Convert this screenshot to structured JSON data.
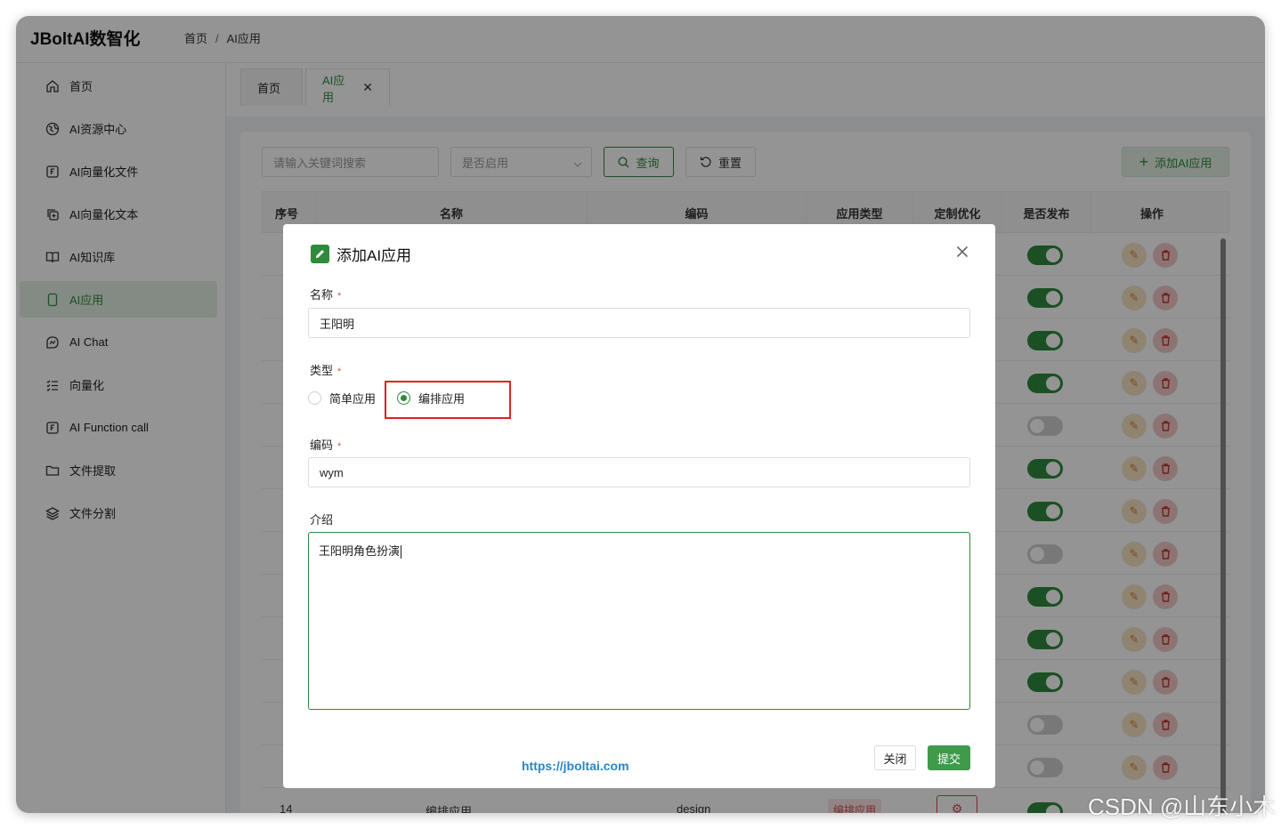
{
  "app": {
    "brand": "JBoltAI数智化"
  },
  "breadcrumb": {
    "home": "首页",
    "separator": "/",
    "current": "AI应用"
  },
  "sidebar": {
    "items": [
      {
        "label": "首页",
        "icon": "home-icon"
      },
      {
        "label": "AI资源中心",
        "icon": "globe-icon"
      },
      {
        "label": "AI向量化文件",
        "icon": "file-f-icon"
      },
      {
        "label": "AI向量化文本",
        "icon": "copy-plus-icon"
      },
      {
        "label": "AI知识库",
        "icon": "book-icon"
      },
      {
        "label": "AI应用",
        "icon": "phone-icon",
        "active": true
      },
      {
        "label": "AI Chat",
        "icon": "chat-icon"
      },
      {
        "label": "向量化",
        "icon": "list-icon"
      },
      {
        "label": "AI Function call",
        "icon": "function-icon"
      },
      {
        "label": "文件提取",
        "icon": "folder-icon"
      },
      {
        "label": "文件分割",
        "icon": "layers-icon"
      }
    ]
  },
  "tabs": [
    {
      "label": "首页"
    },
    {
      "label": "AI应用",
      "close": "✕"
    }
  ],
  "toolbar": {
    "search_placeholder": "请输入关键词搜索",
    "select_placeholder": "是否启用",
    "query_label": "查询",
    "reset_label": "重置",
    "add_label": "添加AI应用"
  },
  "table": {
    "headers": [
      "序号",
      "名称",
      "编码",
      "应用类型",
      "定制优化",
      "是否发布",
      "操作"
    ],
    "published": [
      true,
      true,
      true,
      true,
      false,
      true,
      true,
      false,
      true,
      true,
      true,
      false,
      false
    ],
    "last_row": {
      "index": "14",
      "name": "编排应用",
      "code": "design",
      "type": "编排应用"
    }
  },
  "modal": {
    "title": "添加AI应用",
    "name_label": "名称",
    "required_mark": "*",
    "name_value": "王阳明",
    "type_label": "类型",
    "type_options": [
      "简单应用",
      "编排应用"
    ],
    "type_selected": "编排应用",
    "code_label": "编码",
    "code_value": "wym",
    "intro_label": "介绍",
    "intro_value": "王阳明角色扮演",
    "link": "https://jboltai.com",
    "close_label": "关闭",
    "submit_label": "提交"
  },
  "watermark": "CSDN @山东小木",
  "colors": {
    "accent": "#2f8a3e",
    "danger": "#d24b4b",
    "link": "#2b86c5"
  }
}
